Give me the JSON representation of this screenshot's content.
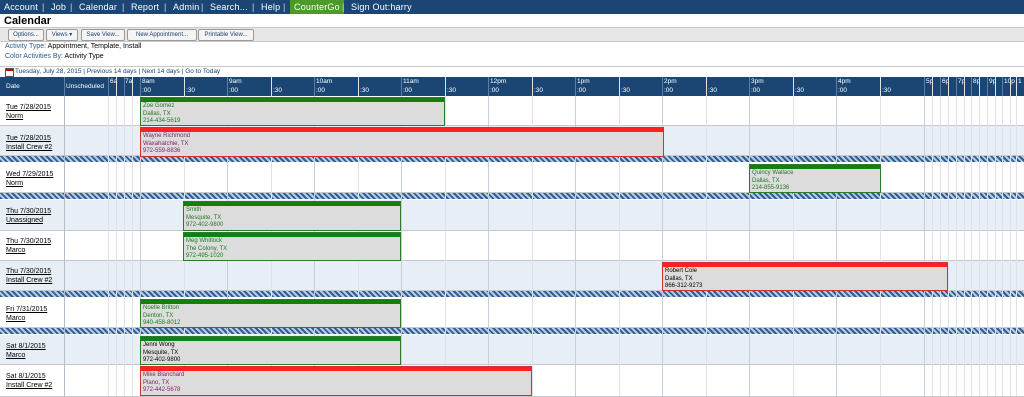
{
  "nav": {
    "items": [
      "Account",
      "Job",
      "Calendar",
      "Report",
      "Admin",
      "Search...",
      "Help",
      "CounterGo",
      "Sign Out:harry"
    ]
  },
  "page_title": "Calendar",
  "toolbar": {
    "options": "Options...",
    "views": "Views ▾",
    "save_view": "Save View...",
    "new_appointment": "New Appointment...",
    "printable_view": "Printable View..."
  },
  "info": {
    "activity_type_label": "Activity Type:",
    "activity_type_value": "Appointment, Template, Install",
    "color_by_label": "Color Activities By:",
    "color_by_value": "Activity Type"
  },
  "datenav": {
    "current": "Tuesday, July 28, 2015",
    "prev": "Previous 14 days",
    "next": "Next 14 days",
    "today": "Go to Today"
  },
  "grid_header": {
    "date": "Date",
    "unscheduled": "Unscheduled",
    "early_hours": [
      "6a",
      "7a"
    ],
    "hours": [
      "8am",
      "9am",
      "10am",
      "11am",
      "12pm",
      "1pm",
      "2pm",
      "3pm",
      "4pm"
    ],
    "late_hours": [
      "5p",
      "6p",
      "7p",
      "8p",
      "9p",
      "10p",
      "1"
    ],
    "half_labels": [
      ":00",
      ":30"
    ]
  },
  "rows": [
    {
      "date": "Tue 7/28/2015",
      "who": "Norm"
    },
    {
      "date": "Tue 7/28/2015",
      "who": "Install Crew #2"
    },
    {
      "date": "Wed 7/29/2015",
      "who": "Norm"
    },
    {
      "date": "Thu 7/30/2015",
      "who": "Unassigned"
    },
    {
      "date": "Thu 7/30/2015",
      "who": "Marco"
    },
    {
      "date": "Thu 7/30/2015",
      "who": "Install Crew #2"
    },
    {
      "date": "Fri 7/31/2015",
      "who": "Marco"
    },
    {
      "date": "Sat 8/1/2015",
      "who": "Marco"
    },
    {
      "date": "Sat 8/1/2015",
      "who": "Install Crew #2"
    }
  ],
  "appointments": [
    {
      "name": "Zoe Gomez",
      "city": "Dallas, TX",
      "phone": "214-434-5619",
      "color": "green"
    },
    {
      "name": "Wayne Richmond",
      "city": "Waxahatchie, TX",
      "phone": "972-559-8836",
      "color": "red"
    },
    {
      "name": "Quincy Wallace",
      "city": "Dallas, TX",
      "phone": "214-855-9136",
      "color": "green"
    },
    {
      "name": "Smith",
      "city": "Mesquite, TX",
      "phone": "972-402-9800",
      "color": "green"
    },
    {
      "name": "Meg Whitlock",
      "city": "The Colony, TX",
      "phone": "972-495-1020",
      "color": "green"
    },
    {
      "name": "Robert Cole",
      "city": "Dallas, TX",
      "phone": "866-312-9273",
      "color": "red"
    },
    {
      "name": "Noelle Britton",
      "city": "Denton, TX",
      "phone": "940-458-8012",
      "color": "green"
    },
    {
      "name": "Jenni Wong",
      "city": "Mesquite, TX",
      "phone": "972-402-9800",
      "color": "green"
    },
    {
      "name": "Mike Blanchard",
      "city": "Plano, TX",
      "phone": "972-442-5678",
      "color": "red"
    }
  ]
}
